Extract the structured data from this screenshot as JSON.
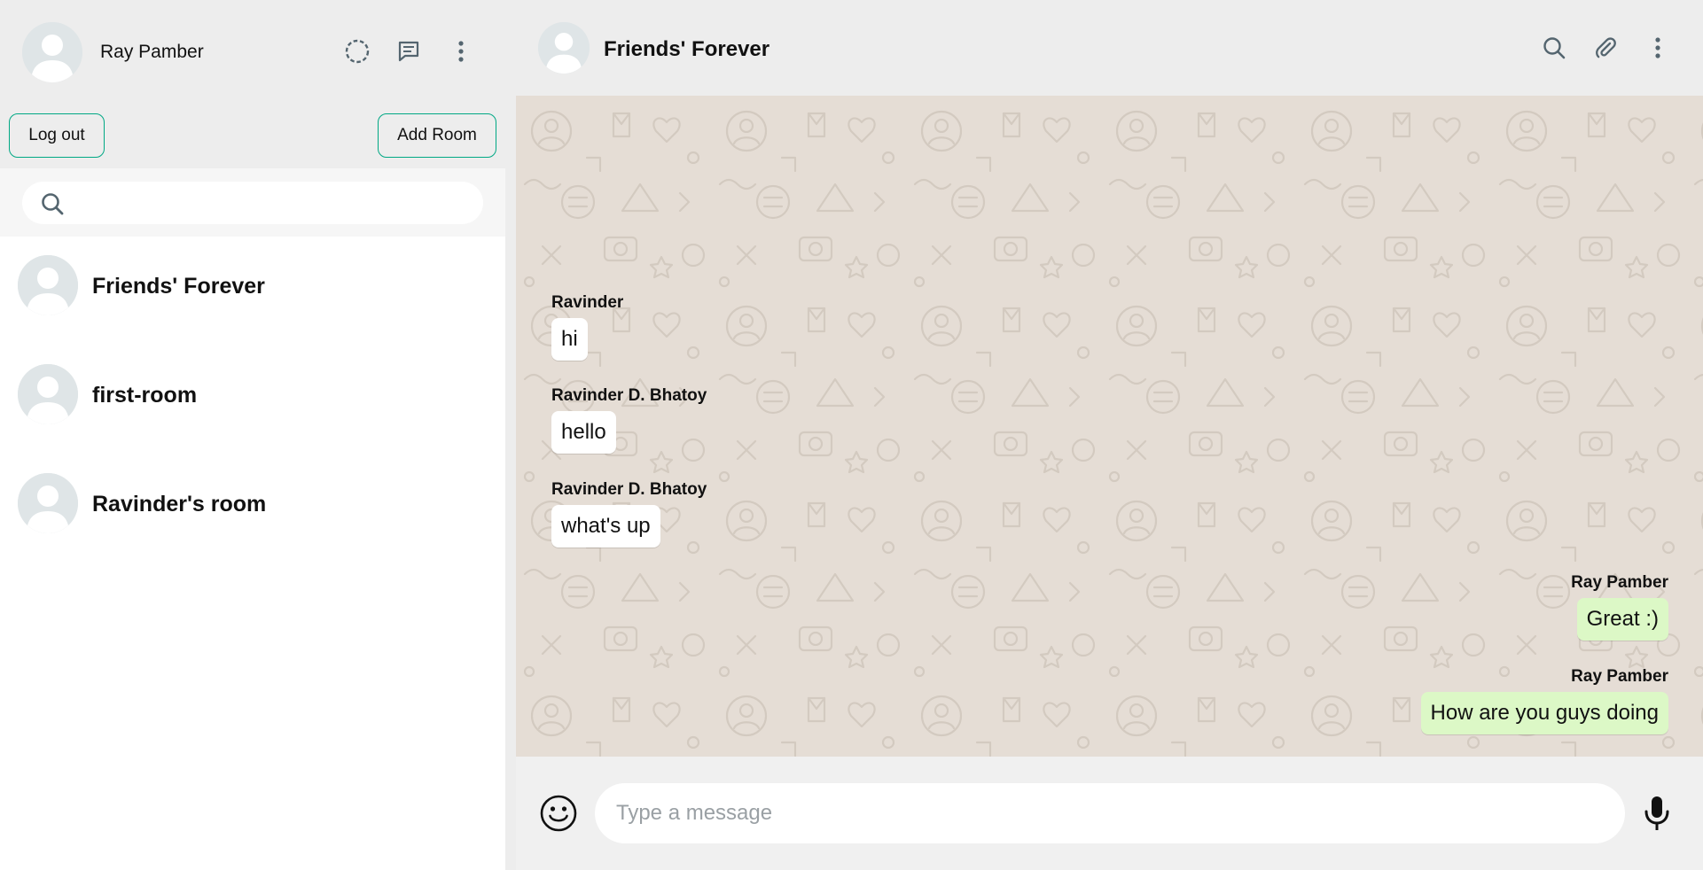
{
  "sidebar": {
    "username": "Ray Pamber",
    "icons": {
      "status": "status-ring-icon",
      "new_chat": "chat-icon",
      "menu": "kebab-menu-icon"
    },
    "logout_label": "Log out",
    "add_room_label": "Add Room",
    "search": {
      "placeholder": "",
      "icon": "search-icon"
    },
    "rooms": [
      {
        "name": "Friends' Forever"
      },
      {
        "name": "first-room"
      },
      {
        "name": "Ravinder's room"
      }
    ]
  },
  "chat": {
    "title": "Friends' Forever",
    "icons": {
      "search": "search-icon",
      "attach": "paperclip-icon",
      "menu": "kebab-menu-icon"
    },
    "messages": [
      {
        "sender": "Ravinder",
        "text": "hi",
        "direction": "received"
      },
      {
        "sender": "Ravinder D. Bhatoy",
        "text": "hello",
        "direction": "received"
      },
      {
        "sender": "Ravinder D. Bhatoy",
        "text": "what's up",
        "direction": "received"
      },
      {
        "sender": "Ray Pamber",
        "text": "Great :)",
        "direction": "sent"
      },
      {
        "sender": "Ray Pamber",
        "text": "How are you guys doing",
        "direction": "sent"
      }
    ],
    "footer": {
      "placeholder": "Type a message",
      "value": "",
      "icons": {
        "emoji": "smiley-icon",
        "mic": "microphone-icon"
      }
    }
  },
  "colors": {
    "accent": "#00a884",
    "sent_bubble": "#dcf8c6",
    "received_bubble": "#ffffff",
    "chat_background": "#e5ddd5",
    "header_background": "#ededed"
  }
}
